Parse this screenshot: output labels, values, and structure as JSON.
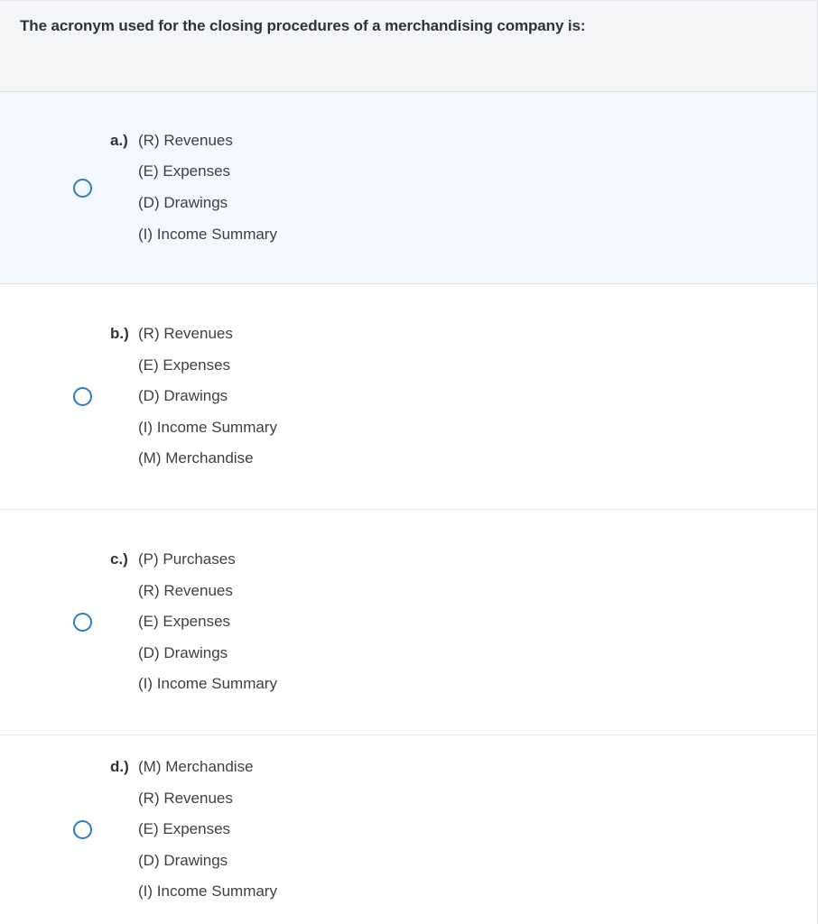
{
  "question": {
    "text": "The acronym used for the closing procedures of a merchandising company is:"
  },
  "colors": {
    "accent": "#2b7dc1",
    "header_background": "#f4f5f7",
    "highlight_background": "#f2f8fd",
    "text": "#3e4044",
    "label_text": "#2f3237",
    "divider": "#e6e7ea"
  },
  "options": [
    {
      "id": "a",
      "letter": "a.)",
      "selected": false,
      "highlighted": true,
      "lines": [
        "(R) Revenues",
        "(E) Expenses",
        "(D) Drawings",
        "(I) Income Summary"
      ]
    },
    {
      "id": "b",
      "letter": "b.)",
      "selected": false,
      "highlighted": false,
      "lines": [
        "(R) Revenues",
        "(E) Expenses",
        "(D) Drawings",
        "(I) Income Summary",
        "(M) Merchandise"
      ]
    },
    {
      "id": "c",
      "letter": "c.)",
      "selected": false,
      "highlighted": false,
      "lines": [
        "(P) Purchases",
        "(R) Revenues",
        "(E) Expenses",
        "(D) Drawings",
        "(I) Income Summary"
      ]
    },
    {
      "id": "d",
      "letter": "d.)",
      "selected": false,
      "highlighted": false,
      "lines": [
        "(M) Merchandise",
        "(R) Revenues",
        "(E) Expenses",
        "(D) Drawings",
        "(I) Income Summary"
      ]
    }
  ]
}
